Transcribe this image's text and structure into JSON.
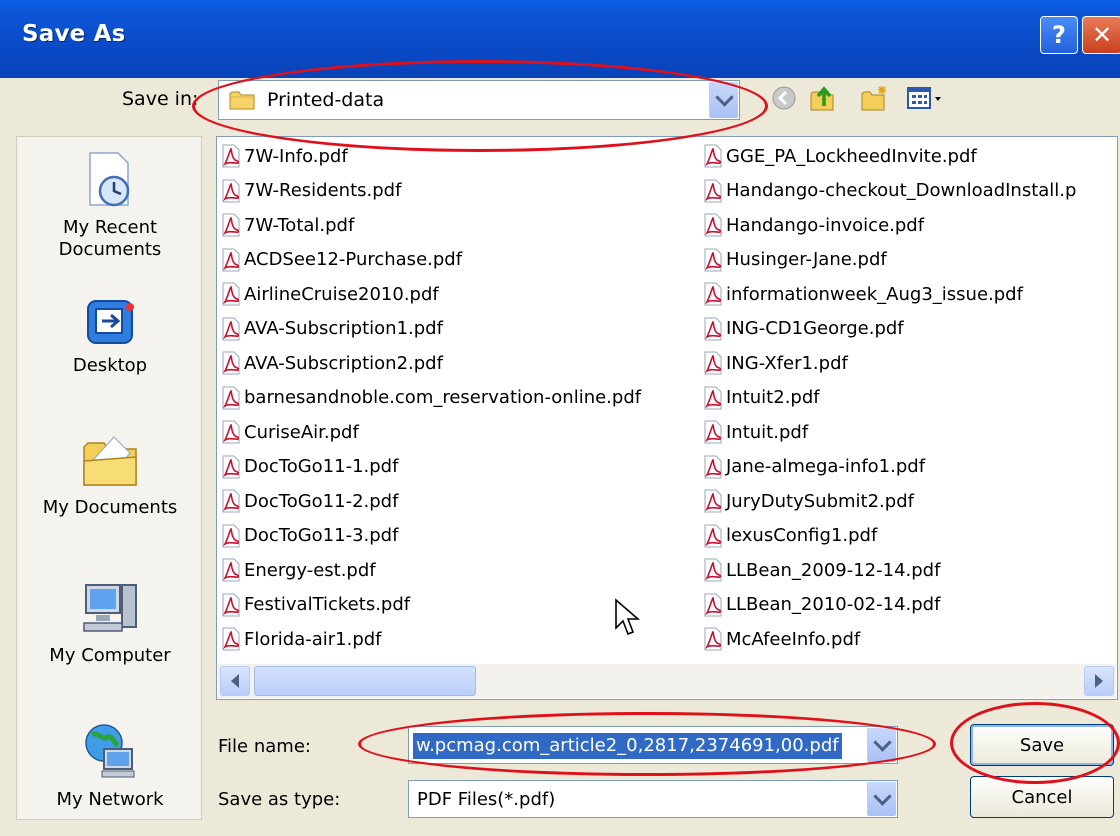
{
  "window": {
    "title": "Save As",
    "help_glyph": "?",
    "close_glyph": "✕"
  },
  "save_in": {
    "label": "Save in:",
    "value": "Printed-data"
  },
  "toolbar": {
    "icons": [
      "back-icon",
      "up-folder-icon",
      "new-folder-icon",
      "views-menu-icon"
    ]
  },
  "places": [
    {
      "id": "recent",
      "label": "My Recent Documents",
      "icon": "clock-document-icon"
    },
    {
      "id": "desktop",
      "label": "Desktop",
      "icon": "desktop-icon"
    },
    {
      "id": "documents",
      "label": "My Documents",
      "icon": "folder-documents-icon"
    },
    {
      "id": "computer",
      "label": "My Computer",
      "icon": "computer-icon"
    },
    {
      "id": "network",
      "label": "My Network",
      "icon": "network-globe-icon"
    }
  ],
  "files": {
    "left": [
      "7W-Info.pdf",
      "7W-Residents.pdf",
      "7W-Total.pdf",
      "ACDSee12-Purchase.pdf",
      "AirlineCruise2010.pdf",
      "AVA-Subscription1.pdf",
      "AVA-Subscription2.pdf",
      "barnesandnoble.com_reservation-online.pdf",
      "CuriseAir.pdf",
      "DocToGo11-1.pdf",
      "DocToGo11-2.pdf",
      "DocToGo11-3.pdf",
      "Energy-est.pdf",
      "FestivalTickets.pdf",
      "Florida-air1.pdf"
    ],
    "right": [
      "GGE_PA_LockheedInvite.pdf",
      "Handango-checkout_DownloadInstall.p",
      "Handango-invoice.pdf",
      "Husinger-Jane.pdf",
      "informationweek_Aug3_issue.pdf",
      "ING-CD1George.pdf",
      "ING-Xfer1.pdf",
      "Intuit2.pdf",
      "Intuit.pdf",
      "Jane-almega-info1.pdf",
      "JuryDutySubmit2.pdf",
      "lexusConfig1.pdf",
      "LLBean_2009-12-14.pdf",
      "LLBean_2010-02-14.pdf",
      "McAfeeInfo.pdf"
    ]
  },
  "file_name": {
    "label": "File name:",
    "value": "w.pcmag.com_article2_0,2817,2374691,00.pdf"
  },
  "save_as_type": {
    "label": "Save as type:",
    "value": "PDF Files(*.pdf)"
  },
  "buttons": {
    "save": "Save",
    "cancel": "Cancel"
  },
  "colors": {
    "title_bar": "#0a4bc8",
    "dialog_bg": "#ece9d8",
    "selection": "#316ac5",
    "annotation": "#e0101a"
  }
}
